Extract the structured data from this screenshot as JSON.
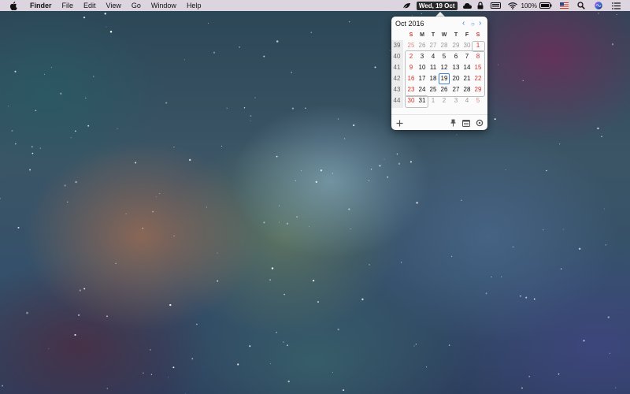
{
  "menubar": {
    "apple_icon": "apple-logo-icon",
    "app_name": "Finder",
    "menus": [
      "File",
      "Edit",
      "View",
      "Go",
      "Window",
      "Help"
    ],
    "status": {
      "date_label": "Wed, 19 Oct",
      "battery_percent": "100%",
      "icons": [
        "leaf-icon",
        "cloud-icon",
        "lock-icon",
        "keyboard-icon",
        "wifi-icon",
        "battery-icon",
        "flag-us-icon",
        "search-icon",
        "siri-icon",
        "list-icon"
      ]
    }
  },
  "calendar": {
    "title": "Oct 2016",
    "nav": {
      "prev": "‹",
      "today": "○",
      "next": "›"
    },
    "weekday_headers": [
      "S",
      "M",
      "T",
      "W",
      "T",
      "F",
      "S"
    ],
    "weeks": [
      {
        "num": "39",
        "days": [
          "25",
          "26",
          "27",
          "28",
          "29",
          "30",
          "1"
        ]
      },
      {
        "num": "40",
        "days": [
          "2",
          "3",
          "4",
          "5",
          "6",
          "7",
          "8"
        ]
      },
      {
        "num": "41",
        "days": [
          "9",
          "10",
          "11",
          "12",
          "13",
          "14",
          "15"
        ]
      },
      {
        "num": "42",
        "days": [
          "16",
          "17",
          "18",
          "19",
          "20",
          "21",
          "22"
        ]
      },
      {
        "num": "43",
        "days": [
          "23",
          "24",
          "25",
          "26",
          "27",
          "28",
          "29"
        ]
      },
      {
        "num": "44",
        "days": [
          "30",
          "31",
          "1",
          "2",
          "3",
          "4",
          "5"
        ]
      }
    ],
    "today": "19",
    "footer_icons": [
      "add-icon",
      "pin-icon",
      "calendar-icon",
      "settings-icon"
    ],
    "colors": {
      "accent": "#3b82d6",
      "weekend": "#d0352f"
    }
  }
}
